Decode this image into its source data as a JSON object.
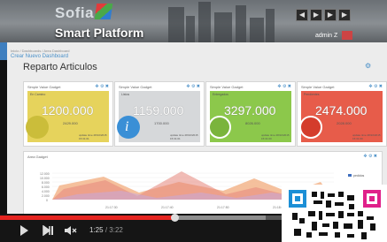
{
  "header": {
    "brand": "Sofia",
    "platform_title": "Smart Platform",
    "buttons": [
      "◀",
      "▶",
      "▶",
      "▶"
    ],
    "user_label": "admin Z"
  },
  "breadcrumb": "Inicio / Dashboards / Area Dashboard",
  "new_dashboard_link": "Crear Nuevo Dashboard",
  "page_title": "Reparto Articulos",
  "widgets": [
    {
      "title": "Simple Value Gadget",
      "controls": "✥ ⚙ ✖",
      "subtitle": "En Camino",
      "value": "1200.000",
      "secondary": "2429.000",
      "date": "update time\n28/10/2015 15:31:01",
      "color": "#e6d35c",
      "icon_color": "#cbbd3a",
      "icon": "cloud-icon"
    },
    {
      "title": "Simple Value Gadget",
      "controls": "✥ ⚙ ✖",
      "subtitle": "Listos",
      "value": "1159.000",
      "secondary": "1700.000",
      "date": "update time\n28/10/2015 15:31:01",
      "color": "#d6d8da",
      "icon_color": "#3a8fd6",
      "icon": "info-icon"
    },
    {
      "title": "Simple Value Gadget",
      "controls": "✥ ⚙ ✖",
      "subtitle": "Entregados",
      "value": "3297.000",
      "secondary": "8026.000",
      "date": "update time\n28/10/2015 15:31:00",
      "color": "#8cc84b",
      "icon_color": "#7ab43c",
      "icon": "check-icon"
    },
    {
      "title": "Simple Value Gadget",
      "controls": "✥ ⚙ ✖",
      "subtitle": "Pendientes",
      "value": "2474.000",
      "secondary": "2028.000",
      "date": "update time\n28/10/2015 15:31:00",
      "color": "#e75c4a",
      "icon_color": "#d43c2c",
      "icon": "power-icon"
    }
  ],
  "area_gadget": {
    "title": "Area Gadget",
    "controls": "✥ ⚙ ✖",
    "y_ticks": [
      "12.000",
      "10.000",
      "8.000",
      "6.000",
      "4.000",
      "2.000",
      "0"
    ],
    "x_ticks": [
      "21:17:30",
      "21:17:40",
      "21:17:50",
      "21:18:00"
    ],
    "legend": "pedidos"
  },
  "video": {
    "current": "1:25",
    "total": "3:22",
    "progress": 0.46
  }
}
